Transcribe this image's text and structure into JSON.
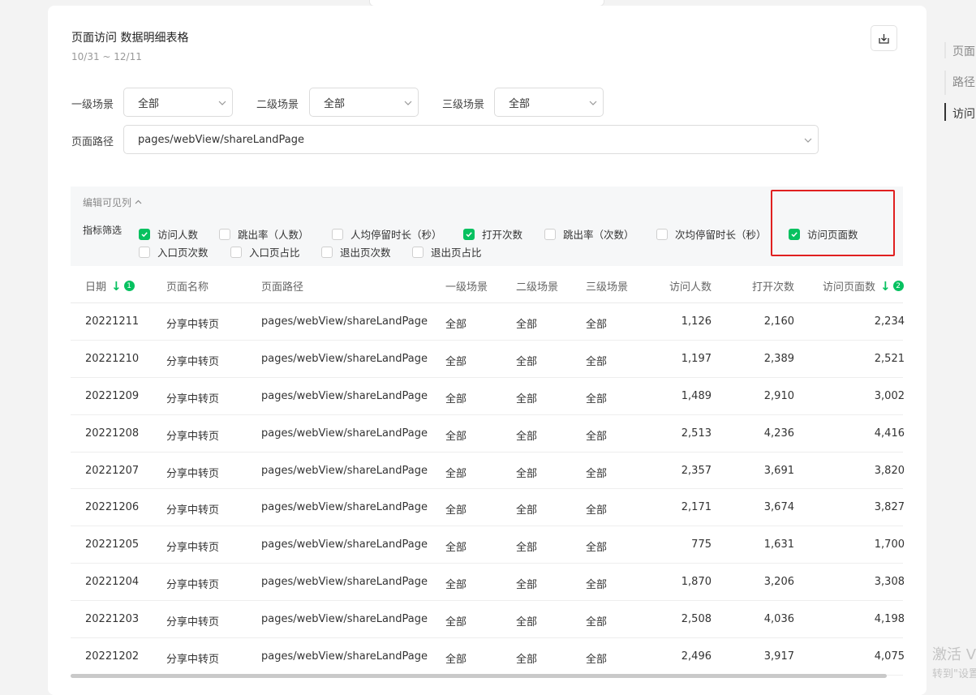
{
  "header": {
    "title": "页面访问 数据明细表格",
    "date_range": "10/31 ~ 12/11"
  },
  "filters": {
    "scene1": {
      "label": "一级场景",
      "value": "全部"
    },
    "scene2": {
      "label": "二级场景",
      "value": "全部"
    },
    "scene3": {
      "label": "三级场景",
      "value": "全部"
    },
    "page_path": {
      "label": "页面路径",
      "value": "pages/webView/shareLandPage"
    }
  },
  "column_panel": {
    "edit_label": "编辑可见列",
    "metrics_label": "指标筛选",
    "metrics": [
      {
        "label": "访问人数",
        "checked": true
      },
      {
        "label": "跳出率（人数）",
        "checked": false
      },
      {
        "label": "人均停留时长（秒）",
        "checked": false
      },
      {
        "label": "打开次数",
        "checked": true
      },
      {
        "label": "跳出率（次数）",
        "checked": false
      },
      {
        "label": "次均停留时长（秒）",
        "checked": false
      },
      {
        "label": "访问页面数",
        "checked": true
      },
      {
        "label": "入口页次数",
        "checked": false
      },
      {
        "label": "入口页占比",
        "checked": false
      },
      {
        "label": "退出页次数",
        "checked": false
      },
      {
        "label": "退出页占比",
        "checked": false
      }
    ]
  },
  "table": {
    "columns": [
      {
        "label": "日期",
        "sort_rank": "1"
      },
      {
        "label": "页面名称"
      },
      {
        "label": "页面路径"
      },
      {
        "label": "一级场景"
      },
      {
        "label": "二级场景"
      },
      {
        "label": "三级场景"
      },
      {
        "label": "访问人数"
      },
      {
        "label": "打开次数"
      },
      {
        "label": "访问页面数",
        "sort_rank": "2"
      }
    ],
    "rows": [
      [
        "20221211",
        "分享中转页",
        "pages/webView/shareLandPage",
        "全部",
        "全部",
        "全部",
        "1,126",
        "2,160",
        "2,234"
      ],
      [
        "20221210",
        "分享中转页",
        "pages/webView/shareLandPage",
        "全部",
        "全部",
        "全部",
        "1,197",
        "2,389",
        "2,521"
      ],
      [
        "20221209",
        "分享中转页",
        "pages/webView/shareLandPage",
        "全部",
        "全部",
        "全部",
        "1,489",
        "2,910",
        "3,002"
      ],
      [
        "20221208",
        "分享中转页",
        "pages/webView/shareLandPage",
        "全部",
        "全部",
        "全部",
        "2,513",
        "4,236",
        "4,416"
      ],
      [
        "20221207",
        "分享中转页",
        "pages/webView/shareLandPage",
        "全部",
        "全部",
        "全部",
        "2,357",
        "3,691",
        "3,820"
      ],
      [
        "20221206",
        "分享中转页",
        "pages/webView/shareLandPage",
        "全部",
        "全部",
        "全部",
        "2,171",
        "3,674",
        "3,827"
      ],
      [
        "20221205",
        "分享中转页",
        "pages/webView/shareLandPage",
        "全部",
        "全部",
        "全部",
        "775",
        "1,631",
        "1,700"
      ],
      [
        "20221204",
        "分享中转页",
        "pages/webView/shareLandPage",
        "全部",
        "全部",
        "全部",
        "1,870",
        "3,206",
        "3,308"
      ],
      [
        "20221203",
        "分享中转页",
        "pages/webView/shareLandPage",
        "全部",
        "全部",
        "全部",
        "2,508",
        "4,036",
        "4,198"
      ],
      [
        "20221202",
        "分享中转页",
        "pages/webView/shareLandPage",
        "全部",
        "全部",
        "全部",
        "2,496",
        "3,917",
        "4,075"
      ]
    ]
  },
  "right_nav": {
    "items": [
      "页面",
      "路径",
      "访问"
    ],
    "active_index": 2
  },
  "watermark": {
    "line1": "激活 V",
    "line2": "转到\"设置"
  },
  "colors": {
    "accent": "#07c160",
    "highlight": "#e02020"
  }
}
